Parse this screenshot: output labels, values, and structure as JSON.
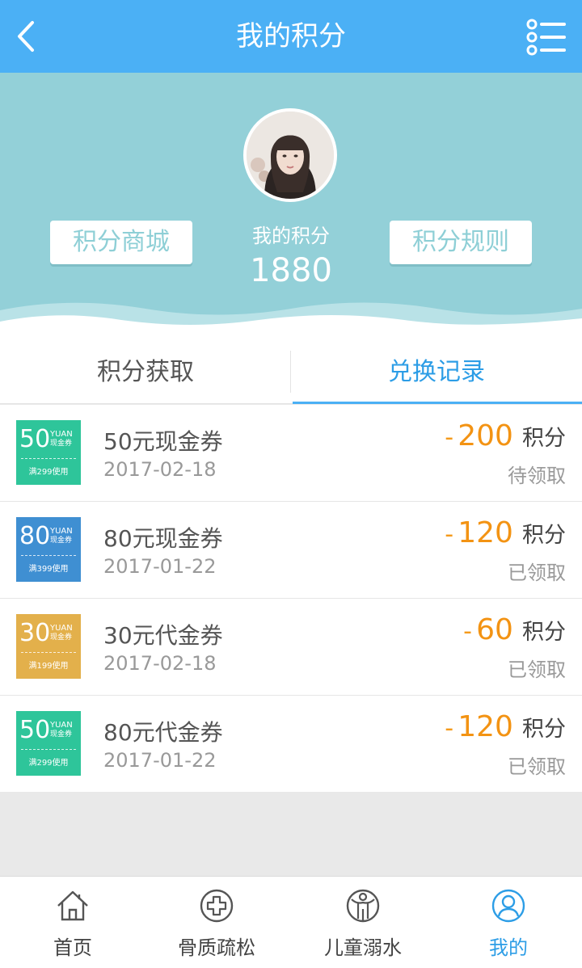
{
  "header": {
    "title": "我的积分",
    "back_icon": "chevron-left-icon",
    "menu_icon": "list-menu-icon"
  },
  "hero": {
    "points_label": "我的积分",
    "points_value": "1880",
    "mall_button": "积分商城",
    "rules_button": "积分规则"
  },
  "tabs": [
    {
      "label": "积分获取",
      "active": false
    },
    {
      "label": "兑换记录",
      "active": true
    }
  ],
  "records": [
    {
      "coupon_amount": "50",
      "coupon_yuan": "YUAN",
      "coupon_type": "现金券",
      "coupon_condition": "满299使用",
      "coupon_color": "#2ec59a",
      "name": "50元现金券",
      "date": "2017-02-18",
      "sign": "-",
      "points": "200",
      "unit": "积分",
      "status": "待领取"
    },
    {
      "coupon_amount": "80",
      "coupon_yuan": "YUAN",
      "coupon_type": "现金券",
      "coupon_condition": "满399使用",
      "coupon_color": "#3f8fd2",
      "name": "80元现金券",
      "date": "2017-01-22",
      "sign": "-",
      "points": "120",
      "unit": "积分",
      "status": "已领取"
    },
    {
      "coupon_amount": "30",
      "coupon_yuan": "YUAN",
      "coupon_type": "现金券",
      "coupon_condition": "满199使用",
      "coupon_color": "#e3b04b",
      "name": "30元代金券",
      "date": "2017-02-18",
      "sign": "-",
      "points": "60",
      "unit": "积分",
      "status": "已领取"
    },
    {
      "coupon_amount": "50",
      "coupon_yuan": "YUAN",
      "coupon_type": "现金券",
      "coupon_condition": "满299使用",
      "coupon_color": "#2ec59a",
      "name": "80元代金券",
      "date": "2017-01-22",
      "sign": "-",
      "points": "120",
      "unit": "积分",
      "status": "已领取"
    }
  ],
  "bottom_nav": [
    {
      "label": "首页",
      "icon": "home-icon",
      "active": false
    },
    {
      "label": "骨质疏松",
      "icon": "medical-cross-icon",
      "active": false
    },
    {
      "label": "儿童溺水",
      "icon": "child-icon",
      "active": false
    },
    {
      "label": "我的",
      "icon": "user-icon",
      "active": true
    }
  ],
  "colors": {
    "header": "#4bb0f5",
    "hero": "#93d0d8",
    "accent": "#2c9de6",
    "points": "#f39313"
  }
}
